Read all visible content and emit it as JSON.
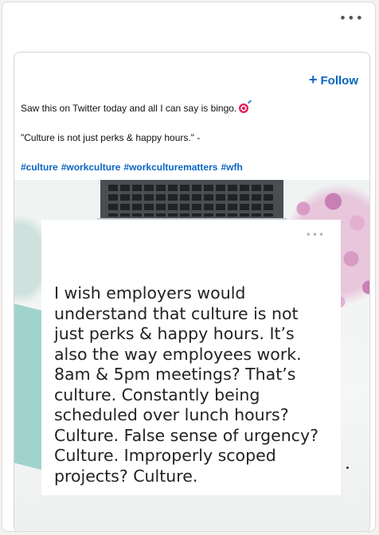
{
  "feed": {
    "menu_icon": "more-horizontal-icon",
    "post": {
      "follow_label": "Follow",
      "follow_icon": "plus-icon",
      "text_line1": "Saw this on Twitter today and all I can say is bingo.",
      "emoji_icon": "direct-hit-target-icon",
      "quote_line": "\"Culture is not just perks & happy hours.\" -",
      "hashtags": [
        "#culture",
        "#workculture",
        "#workculturematters",
        "#wfh"
      ],
      "accent_color": "#0a66c2",
      "image": {
        "tweet_menu_icon": "more-horizontal-icon",
        "tweet_text": "I wish employers would understand that culture is not just perks & happy hours. It’s also the way employees work. 8am & 5pm meetings? That’s culture. Constantly being scheduled over lunch hours? Culture. False sense of urgency? Culture. Improperly scoped projects? Culture."
      }
    }
  }
}
